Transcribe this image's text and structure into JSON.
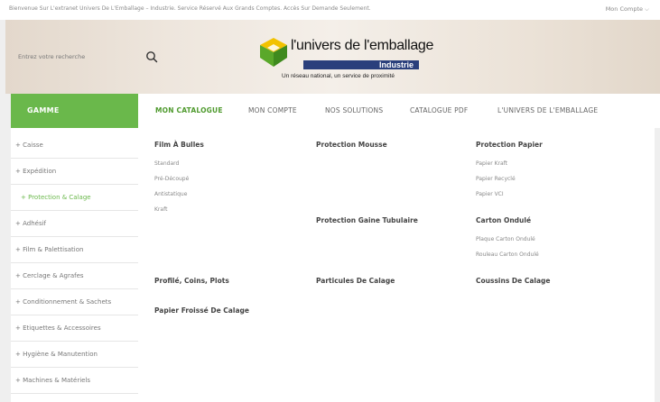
{
  "topbar": {
    "welcome": "Bienvenue Sur L'extranet Univers De L'Emballage – Industrie. Service Réservé Aux Grands Comptes. Accès Sur Demande Seulement.",
    "account": "Mon Compte ⌵"
  },
  "search": {
    "placeholder": "Entrez votre recherche"
  },
  "logo": {
    "brand": "l'univers de l'emballage",
    "industrie": "Industrie",
    "tagline": "Un réseau national, un service de proximité",
    "colors": {
      "green": "#5aa82a",
      "yellow": "#f2c200",
      "navy": "#2a3f7c"
    }
  },
  "gamme_label": "GAMME",
  "nav": {
    "items": [
      "MON CATALOGUE",
      "MON COMPTE",
      "NOS SOLUTIONS",
      "CATALOGUE PDF",
      "L'UNIVERS DE L'EMBALLAGE"
    ],
    "active_index": 0
  },
  "sidebar": {
    "items": [
      "+ Caisse",
      "+ Expédition",
      "+ Protection & Calage",
      "+ Adhésif",
      "+ Film & Palettisation",
      "+ Cerclage & Agrafes",
      "+ Conditionnement & Sachets",
      "+ Etiquettes & Accessoires",
      "+ Hygiène & Manutention",
      "+ Machines & Matériels"
    ],
    "active_index": 2
  },
  "catalog": {
    "col1": {
      "film_heading": "Film À Bulles",
      "film_items": [
        "Standard",
        "Pré-Découpé",
        "Antistatique",
        "Kraft"
      ],
      "profile_heading": "Profilé, Coins, Plots",
      "papier_froisse_heading": "Papier Froissé De Calage"
    },
    "col2": {
      "mousse_heading": "Protection Mousse",
      "gaine_heading": "Protection Gaine Tubulaire",
      "particules_heading": "Particules De Calage"
    },
    "col3": {
      "papier_heading": "Protection Papier",
      "papier_items": [
        "Papier Kraft",
        "Papier Recyclé",
        "Papier VCI"
      ],
      "carton_heading": "Carton Ondulé",
      "carton_items": [
        "Plaque Carton Ondulé",
        "Rouleau Carton Ondulé"
      ],
      "coussins_heading": "Coussins De Calage"
    }
  },
  "colors": {
    "accent_green": "#6ab84b",
    "nav_active": "#4f9a2e"
  }
}
